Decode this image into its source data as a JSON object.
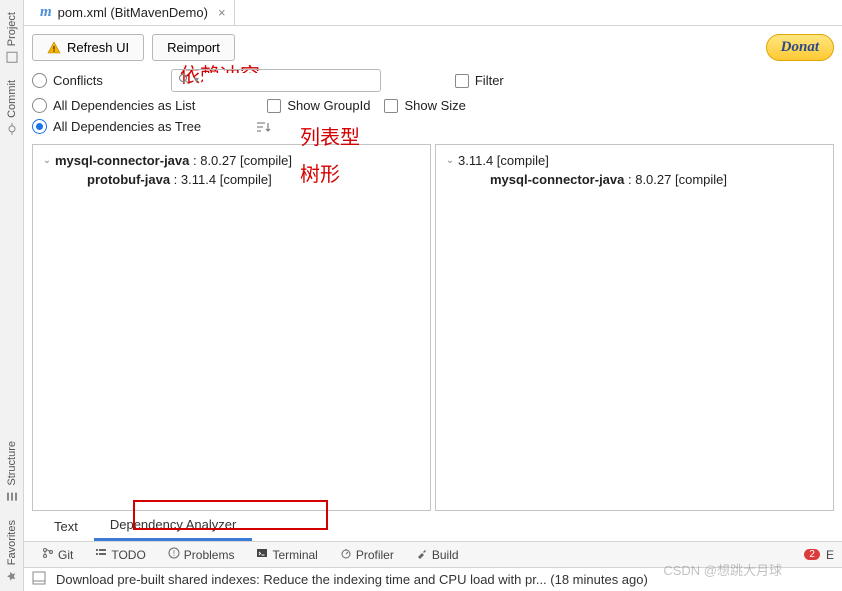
{
  "tab": {
    "file_label": "pom.xml (BitMavenDemo)"
  },
  "toolbar": {
    "refresh": "Refresh UI",
    "reimport": "Reimport",
    "donate": "Donat"
  },
  "filters": {
    "conflicts": "Conflicts",
    "all_list": "All Dependencies as List",
    "all_tree": "All Dependencies as Tree",
    "show_groupid": "Show GroupId",
    "show_size": "Show Size",
    "filter": "Filter",
    "search_placeholder": ""
  },
  "annotations": {
    "conflicts": "依赖冲突",
    "list": "列表型",
    "tree": "树形"
  },
  "tree_left": [
    {
      "indent": 0,
      "caret": true,
      "bold": "mysql-connector-java",
      "ver": "8.0.27",
      "scope": "[compile]"
    },
    {
      "indent": 1,
      "caret": false,
      "bold": "protobuf-java",
      "ver": "3.11.4",
      "scope": "[compile]"
    }
  ],
  "tree_right": [
    {
      "indent": 0,
      "caret": true,
      "plain": "3.11.4",
      "scope": "[compile]"
    },
    {
      "indent": 1,
      "caret": false,
      "bold": "mysql-connector-java",
      "ver": "8.0.27",
      "scope": "[compile]"
    }
  ],
  "editor_tabs": {
    "text": "Text",
    "dep": "Dependency Analyzer"
  },
  "bottom": {
    "git": "Git",
    "todo": "TODO",
    "problems": "Problems",
    "terminal": "Terminal",
    "profiler": "Profiler",
    "build": "Build",
    "badge": "2",
    "extra": "E"
  },
  "status": {
    "msg": "Download pre-built shared indexes: Reduce the indexing time and CPU load with pr... (18 minutes ago)"
  },
  "rail": {
    "project": "Project",
    "commit": "Commit",
    "structure": "Structure",
    "favorites": "Favorites"
  },
  "watermark": "CSDN @想跳大月球"
}
